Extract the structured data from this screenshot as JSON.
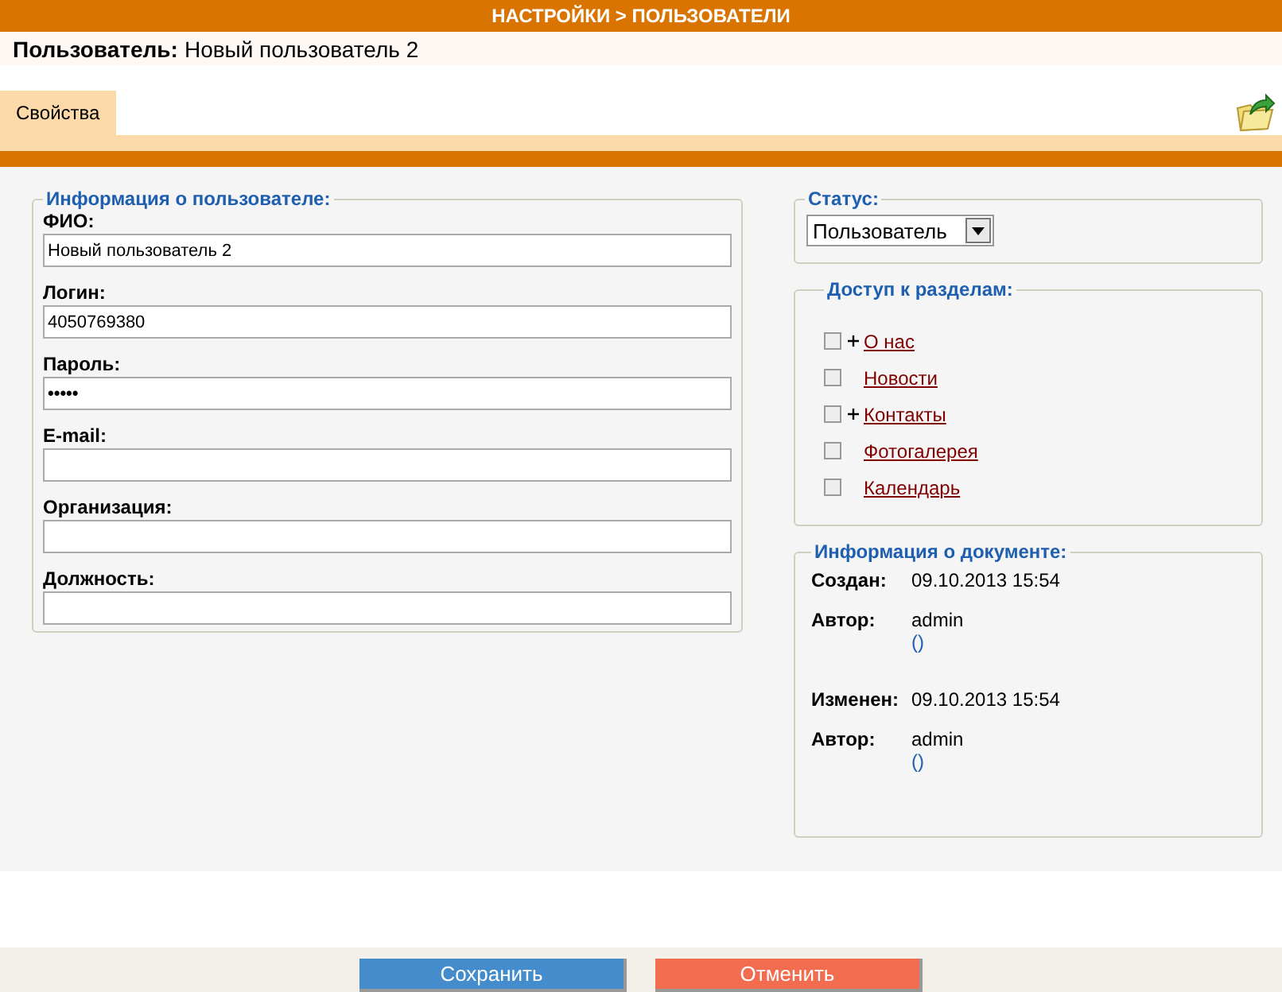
{
  "header": {
    "title": "НАСТРОЙКИ > ПОЛЬЗОВАТЕЛИ"
  },
  "user_line": {
    "label": "Пользователь:",
    "value": "Новый пользователь 2"
  },
  "tabs": [
    {
      "label": "Свойства",
      "selected": true
    }
  ],
  "user_info": {
    "legend": "Информация о пользователе:",
    "fields": [
      {
        "label": "ФИО:",
        "value": "Новый пользователь 2",
        "kind": "text"
      },
      {
        "label": "Логин:",
        "value": "4050769380",
        "kind": "text"
      },
      {
        "label": "Пароль:",
        "value": "•••••",
        "kind": "password"
      },
      {
        "label": "E-mail:",
        "kind": "text"
      },
      {
        "label": "Организация:",
        "kind": "text"
      },
      {
        "label": "Должность:",
        "kind": "text"
      }
    ]
  },
  "status": {
    "legend": "Статус:",
    "value": "Пользователь"
  },
  "access": {
    "legend": "Доступ к разделам:",
    "sections": [
      {
        "name": "О нас",
        "checked": false,
        "expandable": true
      },
      {
        "name": "Новости",
        "checked": false,
        "expandable": false
      },
      {
        "name": "Контакты",
        "checked": false,
        "expandable": true
      },
      {
        "name": "Фотогалерея",
        "checked": false,
        "expandable": false
      },
      {
        "name": "Календарь",
        "checked": false,
        "expandable": false
      }
    ]
  },
  "doc_info": {
    "legend": "Информация о документе:",
    "rows": [
      {
        "label": "Создан:",
        "value": "09.10.2013 15:54"
      },
      {
        "label": "Автор:",
        "value": "admin",
        "sub": "()"
      },
      {
        "label": "Изменен:",
        "value": "09.10.2013 15:54"
      },
      {
        "label": "Автор:",
        "value": "admin",
        "sub": "()"
      }
    ]
  },
  "buttons": [
    {
      "label": "Сохранить",
      "kind": "save"
    },
    {
      "label": "Отменить",
      "kind": "cancel"
    }
  ]
}
